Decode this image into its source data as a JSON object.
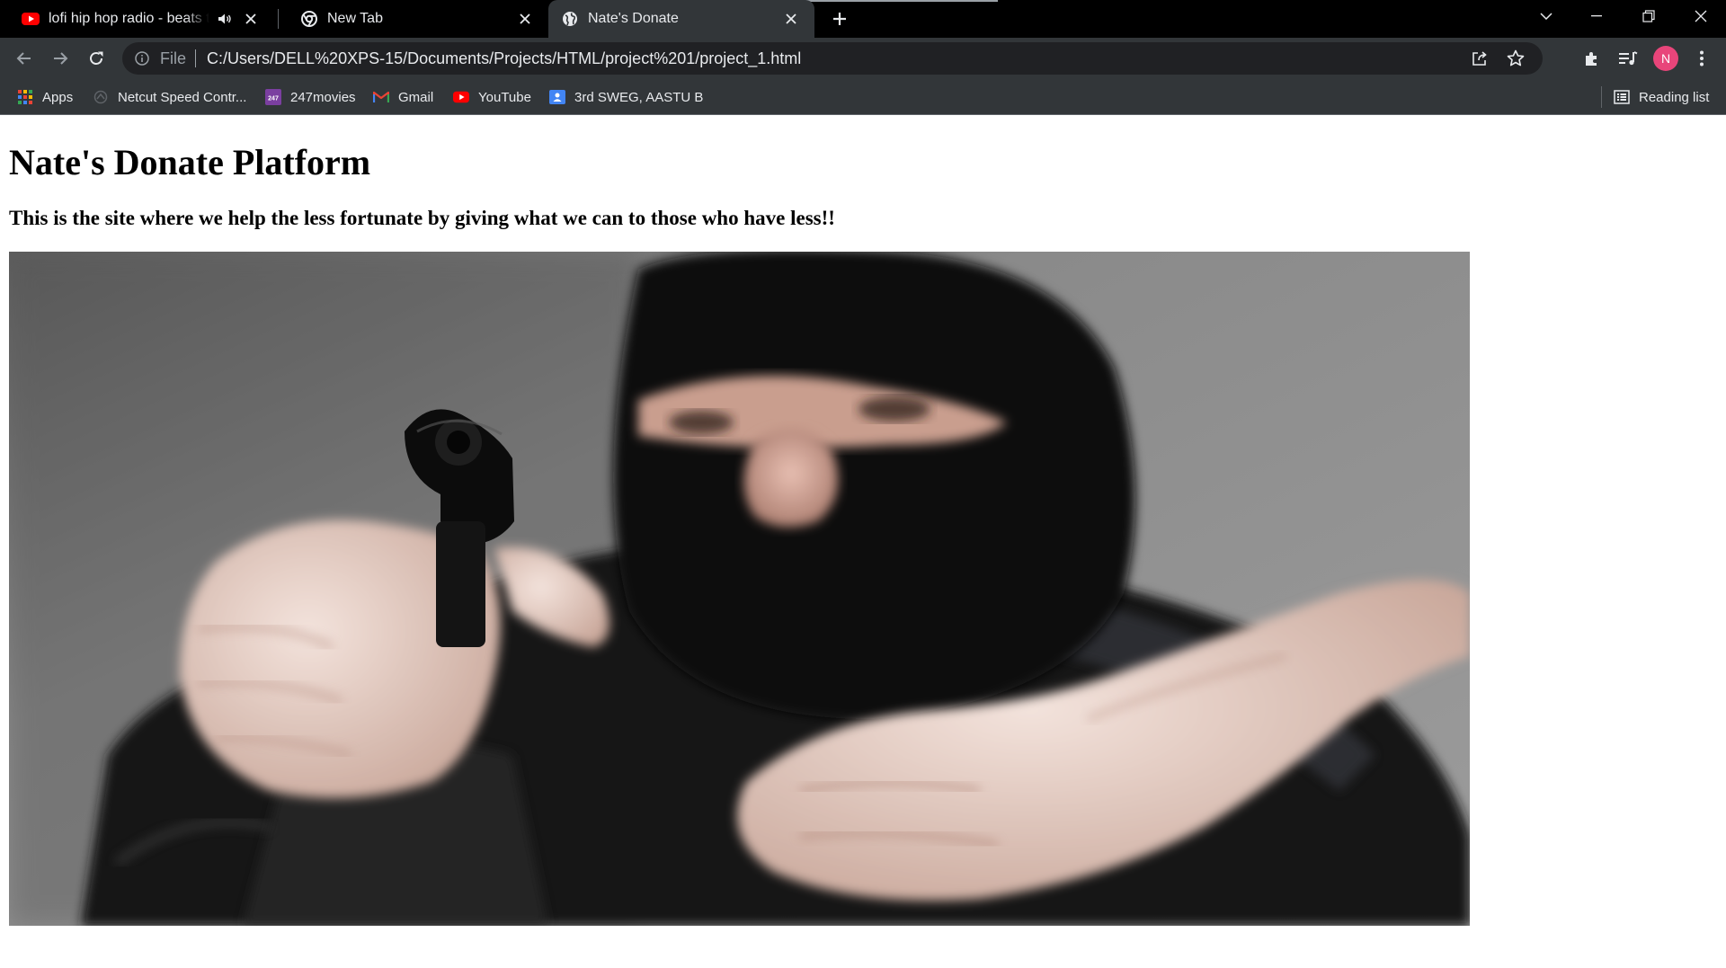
{
  "browser": {
    "tabs": [
      {
        "title": "lofi hip hop radio - beats to r",
        "favicon": "youtube-icon",
        "audio": true
      },
      {
        "title": "New Tab",
        "favicon": "chrome-icon"
      },
      {
        "title": "Nate's Donate",
        "favicon": "globe-icon",
        "active": true
      }
    ],
    "address": {
      "scheme": "File",
      "url": "C:/Users/DELL%20XPS-15/Documents/Projects/HTML/project%201/project_1.html"
    },
    "profile_initial": "N",
    "profile_color": "#e8457a",
    "bookmarks": [
      {
        "label": "Apps",
        "icon": "apps-grid-icon"
      },
      {
        "label": "Netcut Speed Contr...",
        "icon": "netcut-icon"
      },
      {
        "label": "247movies",
        "icon": "247movies-icon"
      },
      {
        "label": "Gmail",
        "icon": "gmail-icon"
      },
      {
        "label": "YouTube",
        "icon": "youtube-icon"
      },
      {
        "label": "3rd SWEG, AASTU B",
        "icon": "google-classroom-icon"
      }
    ],
    "reading_list_label": "Reading list"
  },
  "page": {
    "heading": "Nate's Donate Platform",
    "subheading": "This is the site where we help the less fortunate by giving what we can to those who have less!!"
  },
  "colors": {
    "chrome_dark": "#000000",
    "toolbar": "#323639",
    "omnibox": "#202124",
    "text_light": "#e8eaed"
  }
}
